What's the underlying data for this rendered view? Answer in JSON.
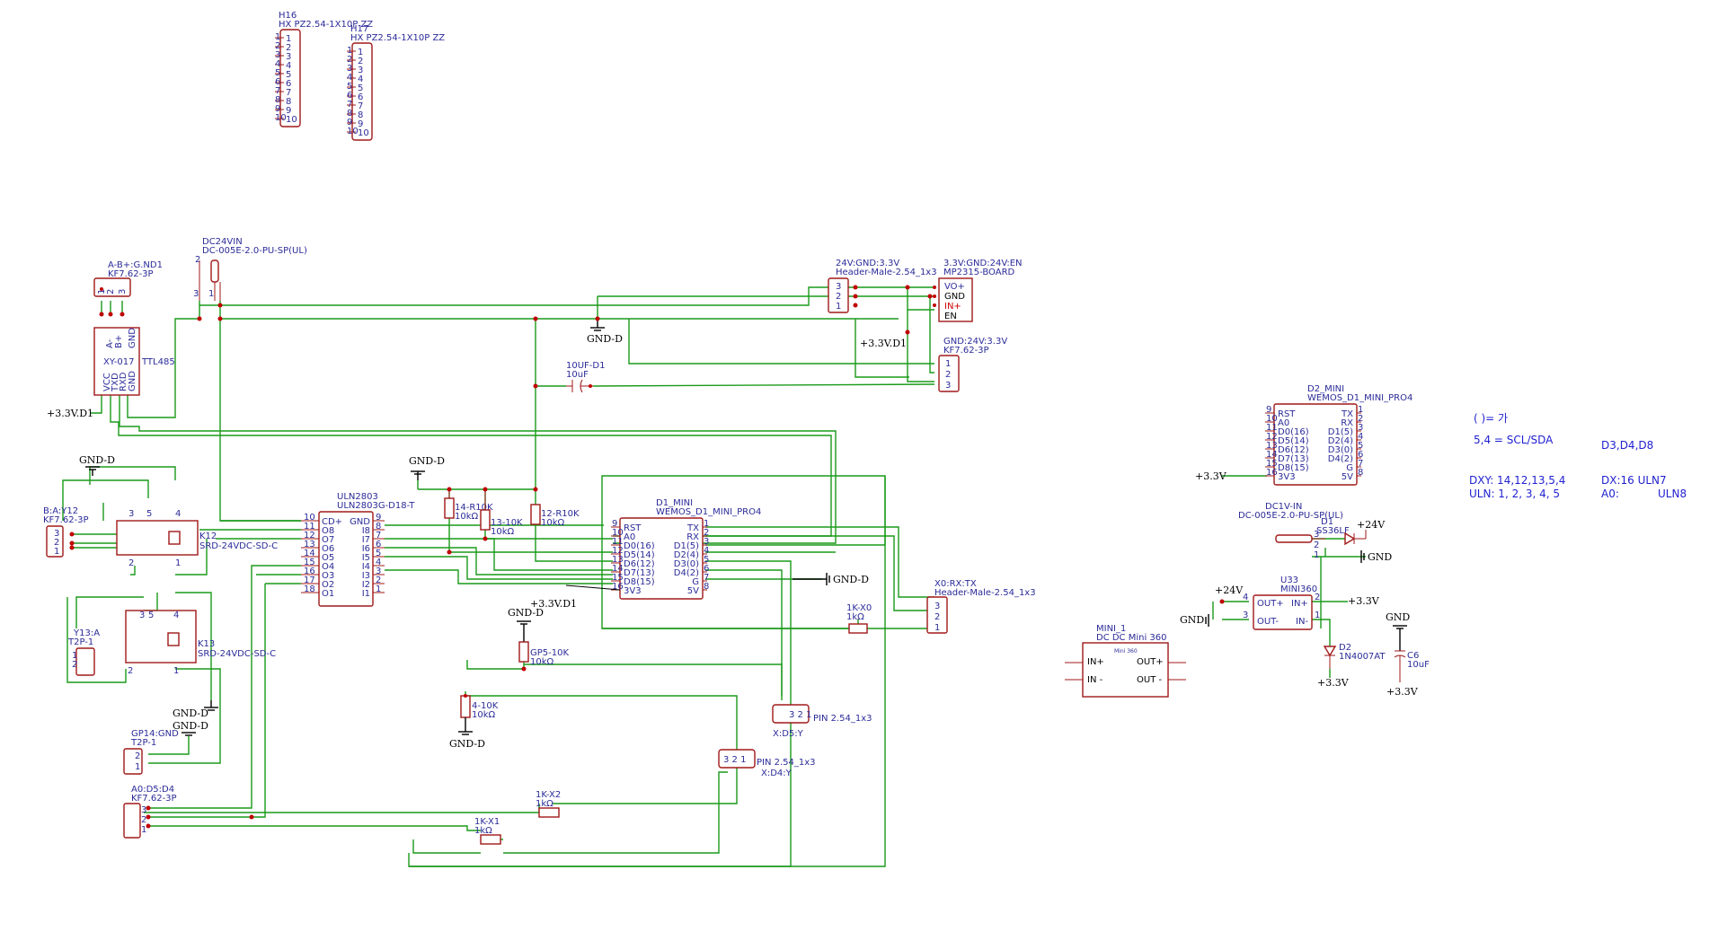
{
  "connectors": {
    "h16": {
      "ref": "H16",
      "value": "HX PZ2.54-1X10P ZZ",
      "pins": [
        "1",
        "2",
        "3",
        "4",
        "5",
        "6",
        "7",
        "8",
        "9",
        "10"
      ]
    },
    "h17": {
      "ref": "H17",
      "value": "HX PZ2.54-1X10P ZZ",
      "pins": [
        "1",
        "2",
        "3",
        "4",
        "5",
        "6",
        "7",
        "8",
        "9",
        "10"
      ]
    },
    "a_b_gnd1": {
      "ref": "A-B+:G.ND1",
      "value": "KF7.62-3P",
      "pins": [
        "1",
        "2",
        "3"
      ]
    },
    "dc24vin": {
      "ref": "DC24VIN",
      "value": "DC-005E-2.0-PU-SP(UL)",
      "pins": [
        "2",
        "3",
        "1"
      ]
    },
    "hdr_24v": {
      "ref": "24V:GND:3.3V",
      "value": "Header-Male-2.54_1x3",
      "pins": [
        "3",
        "2",
        "1"
      ]
    },
    "mp2315": {
      "ref": "3.3V:GND:24V:EN",
      "value": "MP2315-BOARD",
      "pins": [
        "VO+",
        "GND",
        "IN+",
        "EN"
      ]
    },
    "kf_gnd": {
      "ref": "GND:24V:3.3V",
      "value": "KF7.62-3P",
      "pins": [
        "1",
        "2",
        "3"
      ]
    },
    "b_a_y12": {
      "ref": "B:A:Y12",
      "value": "KF7.62-3P",
      "pins": [
        "3",
        "2",
        "1"
      ]
    },
    "y13a": {
      "ref": "Y13:A",
      "value": "T2P-1",
      "pins": [
        "1",
        "2"
      ]
    },
    "gp14": {
      "ref": "GP14:GND",
      "value": "T2P-1",
      "pins": [
        "2",
        "1"
      ]
    },
    "a0d5d4": {
      "ref": "A0:D5:D4",
      "value": "KF7.62-3P",
      "pins": [
        "3",
        "2",
        "1"
      ]
    },
    "x0rxtx": {
      "ref": "X0:RX:TX",
      "value": "Header-Male-2.54_1x3",
      "pins": [
        "3",
        "2",
        "1"
      ]
    },
    "pin_d5": {
      "ref": "PIN 2.54_1x3",
      "net": "X:D5:Y",
      "pins": [
        "3",
        "2",
        "1"
      ]
    },
    "pin_d4": {
      "ref": "PIN 2.54_1x3",
      "net": "X:D4:Y",
      "pins": [
        "3",
        "2",
        "1"
      ]
    },
    "dc1v": {
      "ref": "DC1V-IN",
      "value": "DC-005E-2.0-PU-SP(UL)",
      "pins": [
        "3",
        "2",
        "1"
      ]
    }
  },
  "modules": {
    "ttl485": {
      "label": "XY-017",
      "name": "TTL485",
      "top_pins": [
        "A-",
        "B+",
        "GND"
      ],
      "bottom_pins": [
        "VCC",
        "TXD",
        "RXD",
        "GND"
      ]
    },
    "uln2803": {
      "ref": "ULN2803",
      "value": "ULN2803G-D18-T",
      "left_pins": [
        {
          "n": "10",
          "name": "CD+"
        },
        {
          "n": "11",
          "name": "O8"
        },
        {
          "n": "12",
          "name": "O7"
        },
        {
          "n": "13",
          "name": "O6"
        },
        {
          "n": "14",
          "name": "O5"
        },
        {
          "n": "15",
          "name": "O4"
        },
        {
          "n": "16",
          "name": "O3"
        },
        {
          "n": "17",
          "name": "O2"
        },
        {
          "n": "18",
          "name": "O1"
        }
      ],
      "right_pins": [
        {
          "n": "9",
          "name": "GND"
        },
        {
          "n": "8",
          "name": "I8"
        },
        {
          "n": "7",
          "name": "I7"
        },
        {
          "n": "6",
          "name": "I6"
        },
        {
          "n": "5",
          "name": "I5"
        },
        {
          "n": "4",
          "name": "I4"
        },
        {
          "n": "3",
          "name": "I3"
        },
        {
          "n": "2",
          "name": "I2"
        },
        {
          "n": "1",
          "name": "I1"
        }
      ]
    },
    "d1_mini": {
      "ref": "D1_MINI",
      "value": "WEMOS_D1_MINI_PRO4",
      "left_pins": [
        {
          "n": "9",
          "name": "RST"
        },
        {
          "n": "10",
          "name": "A0"
        },
        {
          "n": "11",
          "name": "D0(16)"
        },
        {
          "n": "12",
          "name": "D5(14)"
        },
        {
          "n": "13",
          "name": "D6(12)"
        },
        {
          "n": "14",
          "name": "D7(13)"
        },
        {
          "n": "15",
          "name": "D8(15)"
        },
        {
          "n": "16",
          "name": "3V3"
        }
      ],
      "right_pins": [
        {
          "n": "1",
          "name": "TX"
        },
        {
          "n": "2",
          "name": "RX"
        },
        {
          "n": "3",
          "name": "D1(5)"
        },
        {
          "n": "4",
          "name": "D2(4)"
        },
        {
          "n": "5",
          "name": "D3(0)"
        },
        {
          "n": "6",
          "name": "D4(2)"
        },
        {
          "n": "7",
          "name": "G"
        },
        {
          "n": "8",
          "name": "5V"
        }
      ]
    },
    "d2_mini": {
      "ref": "D2_MINI",
      "value": "WEMOS_D1_MINI_PRO4",
      "left_pins": [
        {
          "n": "9",
          "name": "RST"
        },
        {
          "n": "10",
          "name": "A0"
        },
        {
          "n": "11",
          "name": "D0(16)"
        },
        {
          "n": "12",
          "name": "D5(14)"
        },
        {
          "n": "13",
          "name": "D6(12)"
        },
        {
          "n": "14",
          "name": "D7(13)"
        },
        {
          "n": "15",
          "name": "D8(15)"
        },
        {
          "n": "16",
          "name": "3V3"
        }
      ],
      "right_pins": [
        {
          "n": "1",
          "name": "TX"
        },
        {
          "n": "2",
          "name": "RX"
        },
        {
          "n": "3",
          "name": "D1(5)"
        },
        {
          "n": "4",
          "name": "D2(4)"
        },
        {
          "n": "5",
          "name": "D3(0)"
        },
        {
          "n": "6",
          "name": "D4(2)"
        },
        {
          "n": "7",
          "name": "G"
        },
        {
          "n": "8",
          "name": "5V"
        }
      ]
    },
    "u33": {
      "ref": "U33",
      "value": "MINI360",
      "pins": [
        {
          "n": "4",
          "name": "OUT+"
        },
        {
          "n": "3",
          "name": "OUT-"
        },
        {
          "n": "2",
          "name": "IN+"
        },
        {
          "n": "1",
          "name": "IN-"
        }
      ]
    },
    "mini1": {
      "ref": "MINI_1",
      "value": "DC DC Mini 360",
      "sub": "Mini 360",
      "pins": [
        "IN+",
        "IN -",
        "OUT+",
        "OUT -"
      ]
    },
    "k12": {
      "ref": "K12",
      "value": "SRD-24VDC-SD-C",
      "pins": [
        "3",
        "5",
        "4",
        "2",
        "1"
      ]
    },
    "k13": {
      "ref": "K13",
      "value": "SRD-24VDC-SD-C",
      "pins": [
        "3",
        "5",
        "4",
        "2",
        "1"
      ]
    }
  },
  "passives": {
    "r14": {
      "ref": "14-R10K",
      "value": "10kΩ"
    },
    "r13": {
      "ref": "13-10K",
      "value": "10kΩ"
    },
    "r12": {
      "ref": "12-R10K",
      "value": "10kΩ"
    },
    "r_gp5": {
      "ref": "GP5-10K",
      "value": "10kΩ"
    },
    "r4": {
      "ref": "4-10K",
      "value": "10kΩ"
    },
    "r_x0": {
      "ref": "1K-X0",
      "value": "1kΩ"
    },
    "r_x2": {
      "ref": "1K-X2",
      "value": "1kΩ"
    },
    "r_x1": {
      "ref": "1K-X1",
      "value": "1kΩ"
    },
    "c_10uf": {
      "ref": "10UF-D1",
      "value": "10uF"
    },
    "c6": {
      "ref": "C6",
      "value": "10uF"
    },
    "d1": {
      "ref": "D1",
      "value": "SS36LF"
    },
    "d2": {
      "ref": "D2",
      "value": "1N4007AT"
    }
  },
  "power": {
    "gnd_d": "GND-D",
    "gnd": "GND",
    "v33_d1": "+3.3V.D1",
    "v33": "+3.3V",
    "v24": "+24V"
  },
  "notes": {
    "n1": "( )=      가",
    "n2": "5,4 = SCL/SDA",
    "n3": "D3,D4,D8",
    "n4": "DXY: 14,12,13,5,4",
    "n5": "DX:16 ULN7",
    "n6": "ULN: 1, 2, 3, 4, 5",
    "n7": "A0:",
    "n8": "ULN8"
  },
  "colors": {
    "wire": "#1a9a1a",
    "component": "#a01818",
    "text": "#2b2b99",
    "junction": "#c00000",
    "note": "#1f1fd0"
  }
}
